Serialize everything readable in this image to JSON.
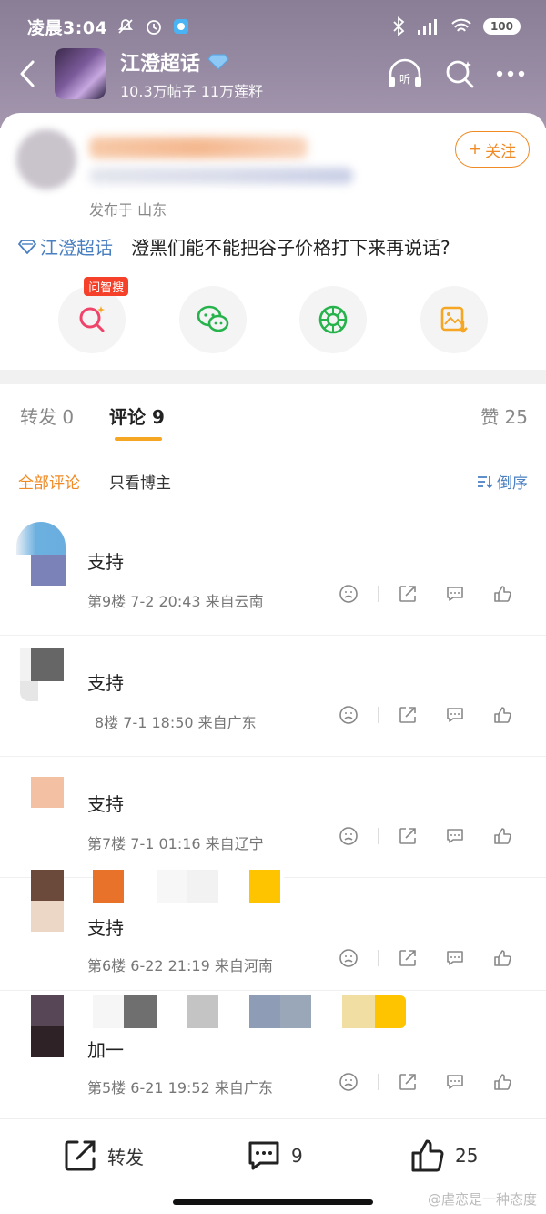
{
  "status": {
    "time": "凌晨3:04",
    "battery": "100"
  },
  "topic": {
    "name": "江澄超话",
    "stats": "10.3万帖子 11万莲籽"
  },
  "post": {
    "location": "发布于 山东",
    "follow_label": "关注",
    "tag": "江澄超话",
    "text": "澄黑们能不能把谷子价格打下来再说话?",
    "ai_badge": "问智搜"
  },
  "tabs": {
    "repost": "转发 0",
    "comments": "评论 9",
    "likes": "赞 25"
  },
  "filters": {
    "all": "全部评论",
    "author": "只看博主",
    "sort": "倒序"
  },
  "comments": [
    {
      "text": "支持",
      "meta": "第9楼 7-2 20:43 来自云南"
    },
    {
      "text": "支持",
      "meta": "8楼 7-1 18:50 来自广东"
    },
    {
      "text": "支持",
      "meta": "第7楼 7-1 01:16 来自辽宁"
    },
    {
      "text": "支持",
      "meta": "第6楼 6-22 21:19 来自河南"
    },
    {
      "text": "加一",
      "meta": "第5楼 6-21 19:52 来自广东"
    }
  ],
  "bottom": {
    "repost": "转发",
    "comments": "9",
    "likes": "25"
  },
  "watermark": "@虐恋是一种态度",
  "colors": {
    "accent": "#f08a24",
    "link": "#4a7fc1",
    "header": "#978aa3"
  }
}
